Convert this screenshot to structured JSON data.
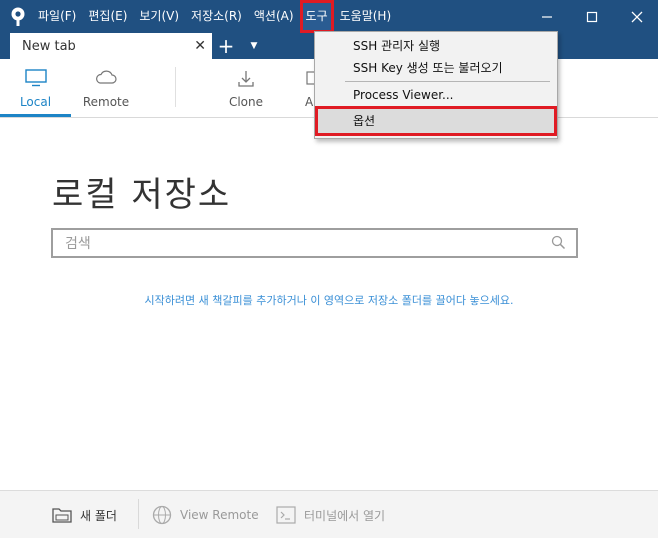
{
  "menu_bar": {
    "items": [
      "파일(F)",
      "편집(E)",
      "보기(V)",
      "저장소(R)",
      "액션(A)",
      "도구",
      "도움말(H)"
    ],
    "open_item": "도구"
  },
  "window_controls": {
    "minimize": "—",
    "maximize": "☐",
    "close": "✕"
  },
  "tabs": {
    "active_label": "New tab",
    "close": "✕",
    "add": "+",
    "menu": "▼"
  },
  "toolbar": {
    "local_label": "Local",
    "remote_label": "Remote",
    "clone_label": "Clone",
    "add_label": "A"
  },
  "main": {
    "title": "로컬 저장소",
    "search_placeholder": "검색",
    "hint": "시작하려면 새 책갈피를 추가하거나 이 영역으로 저장소 폴더를 끌어다 놓으세요."
  },
  "statusbar": {
    "new_folder_label": "새 폴더",
    "view_remote_label": "View Remote",
    "terminal_label": "터미널에서 열기"
  },
  "tools_menu": {
    "items": [
      {
        "label": "SSH 관리자 실행"
      },
      {
        "label": "SSH Key 생성 또는 불러오기"
      },
      {
        "label": "Process Viewer..."
      },
      {
        "label": "옵션"
      }
    ],
    "highlighted": "옵션"
  },
  "colors": {
    "titlebar": "#205081",
    "accent": "#1d84c6",
    "hint_text": "#3a8fd6",
    "highlight_box": "#e01b24"
  }
}
